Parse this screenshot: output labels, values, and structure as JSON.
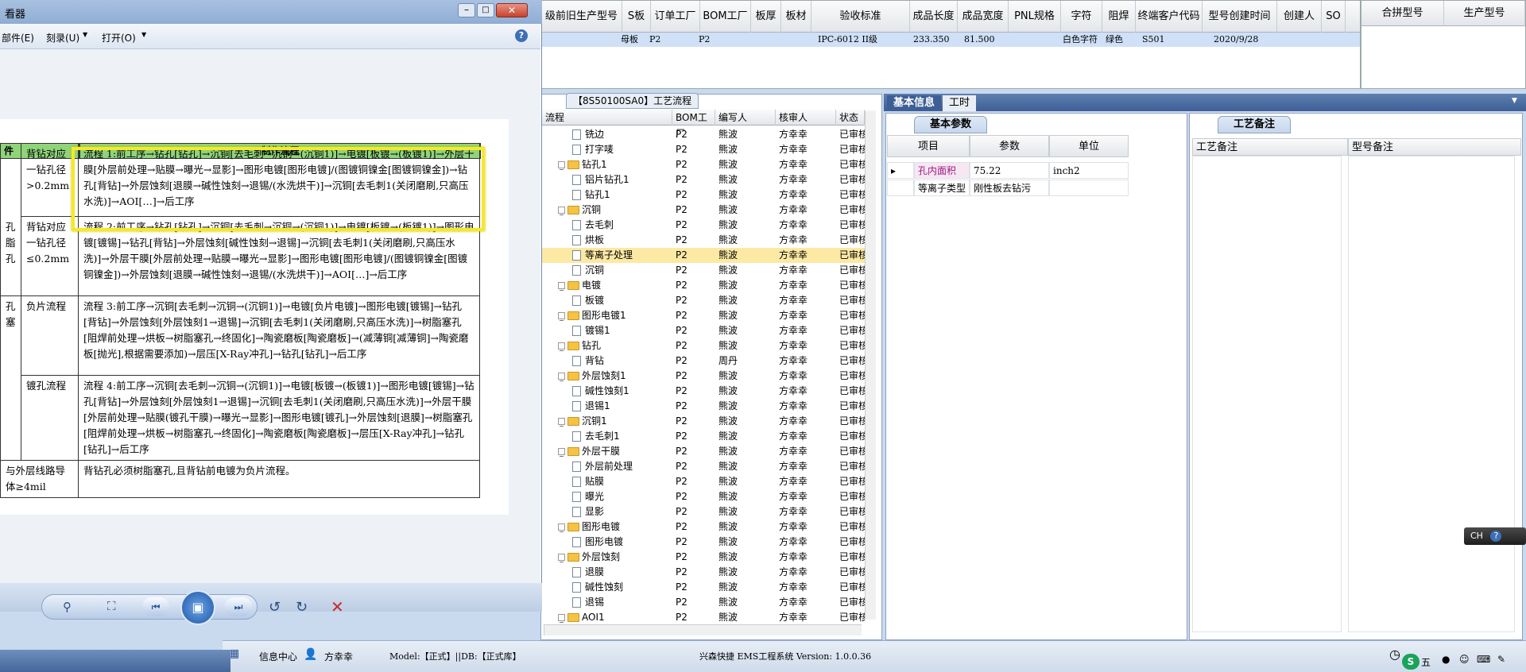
{
  "top_grid": {
    "headers": [
      "级前旧生产型号",
      "S板",
      "订单工厂",
      "BOM工厂",
      "板厚",
      "板材",
      "验收标准",
      "成品长度",
      "成品宽度",
      "PNL规格",
      "字符",
      "阻焊",
      "终端客户代码",
      "型号创建时间",
      "创建人",
      "SO"
    ],
    "row": {
      "s_board": "母板",
      "order_factory": "P2",
      "bom_factory": "P2",
      "standard": "IPC-6012 II级",
      "length": "233.350",
      "width": "81.500",
      "char": "白色字符",
      "mask": "绿色",
      "customer": "S501",
      "created": "2020/9/28"
    },
    "right_headers": [
      "合拼型号",
      "生产型号"
    ]
  },
  "viewer": {
    "title": "看器",
    "menu": [
      "部件(E)",
      "刻录(U)",
      "打开(O)"
    ],
    "table_header_left": "件",
    "table_header_right": "制作流程",
    "rows": [
      {
        "cat": "",
        "cond": "背钻对应一钻孔径>0.2mm",
        "flow": "流程 1:前工序→钻孔[钻孔]→沉铜[去毛刺→沉铜→(沉铜1)]→电镀[板镀→(板镀1)]→外层干膜[外层前处理→贴膜→曝光→显影]→图形电镀[图形电镀]/(图镀铜镍金[图镀铜镍金])→钻孔[背钻]→外层蚀刻[退膜→碱性蚀刻→退锡/(水洗烘干)]→沉铜[去毛刺1(关闭磨刷,只高压水洗)]→AOI[…]→后工序"
      },
      {
        "cat": "孔 脂 孔",
        "cond": "背钻对应一钻孔径≤0.2mm",
        "flow": "流程 2:前工序→钻孔[钻孔]→沉铜[去毛刺→沉铜→(沉铜1)]→电镀[板镀→(板镀1)]→图形电镀[镀锡]→钻孔[背钻]→外层蚀刻[碱性蚀刻→退锡]→沉铜[去毛刺1(关闭磨刷,只高压水洗)]→外层干膜[外层前处理→贴膜→曝光→显影]→图形电镀[图形电镀]/(图镀铜镍金[图镀铜镍金])→外层蚀刻[退膜→碱性蚀刻→退锡/(水洗烘干)]→AOI[…]→后工序"
      },
      {
        "cat": "孔 塞",
        "cond": "负片流程",
        "flow": "流程 3:前工序→沉铜[去毛刺→沉铜→(沉铜1)]→电镀[负片电镀]→图形电镀[镀锡]→钻孔[背钻]→外层蚀刻[外层蚀刻1→退锡]→沉铜[去毛刺1(关闭磨刷,只高压水洗)]→树脂塞孔[阻焊前处理→烘板→树脂塞孔→终固化]→陶瓷磨板[陶瓷磨板]→(减薄铜[减薄铜]→陶瓷磨板[抛光],根据需要添加)→层压[X-Ray冲孔]→钻孔[钻孔]→后工序"
      },
      {
        "cat": "",
        "cond": "镀孔流程",
        "flow": "流程 4:前工序→沉铜[去毛刺→沉铜→(沉铜1)]→电镀[板镀→(板镀1)]→图形电镀[镀锡]→钻孔[背钻]→外层蚀刻[外层蚀刻1→退锡]→沉铜[去毛刺1(关闭磨刷,只高压水洗)]→外层干膜[外层前处理→贴膜(镀孔干膜)→曝光→显影]→图形电镀[镀孔]→外层蚀刻[退膜]→树脂塞孔[阻焊前处理→烘板→树脂塞孔→终固化]→陶瓷磨板[陶瓷磨板]→层压[X-Ray冲孔]→钻孔[钻孔]→后工序"
      },
      {
        "cat": "与外层线路导体≥4mil",
        "cond": "",
        "flow": "背钻孔必须树脂塞孔,且背钻前电镀为负片流程。"
      }
    ]
  },
  "tree": {
    "tab": "【8S50100SA0】工艺流程",
    "headers": [
      "流程",
      "BOM工厂",
      "编写人",
      "核审人",
      "状态"
    ],
    "rows": [
      {
        "lvl": 2,
        "type": "doc",
        "name": "铣边",
        "bom": "P2",
        "w": "熊波",
        "r": "方幸幸",
        "s": "已审核"
      },
      {
        "lvl": 2,
        "type": "doc",
        "name": "打字唛",
        "bom": "P2",
        "w": "熊波",
        "r": "方幸幸",
        "s": "已审核"
      },
      {
        "lvl": 1,
        "type": "fold",
        "name": "钻孔1",
        "bom": "P2",
        "w": "熊波",
        "r": "方幸幸",
        "s": "已审核"
      },
      {
        "lvl": 2,
        "type": "doc",
        "name": "铝片钻孔1",
        "bom": "P2",
        "w": "熊波",
        "r": "方幸幸",
        "s": "已审核"
      },
      {
        "lvl": 2,
        "type": "doc",
        "name": "钻孔1",
        "bom": "P2",
        "w": "熊波",
        "r": "方幸幸",
        "s": "已审核"
      },
      {
        "lvl": 1,
        "type": "fold",
        "name": "沉铜",
        "bom": "P2",
        "w": "熊波",
        "r": "方幸幸",
        "s": "已审核"
      },
      {
        "lvl": 2,
        "type": "doc",
        "name": "去毛刺",
        "bom": "P2",
        "w": "熊波",
        "r": "方幸幸",
        "s": "已审核"
      },
      {
        "lvl": 2,
        "type": "doc",
        "name": "烘板",
        "bom": "P2",
        "w": "熊波",
        "r": "方幸幸",
        "s": "已审核"
      },
      {
        "lvl": 2,
        "type": "doc",
        "name": "等离子处理",
        "bom": "P2",
        "w": "熊波",
        "r": "方幸幸",
        "s": "已审核",
        "sel": true
      },
      {
        "lvl": 2,
        "type": "doc",
        "name": "沉铜",
        "bom": "P2",
        "w": "熊波",
        "r": "方幸幸",
        "s": "已审核"
      },
      {
        "lvl": 1,
        "type": "fold",
        "name": "电镀",
        "bom": "P2",
        "w": "熊波",
        "r": "方幸幸",
        "s": "已审核"
      },
      {
        "lvl": 2,
        "type": "doc",
        "name": "板镀",
        "bom": "P2",
        "w": "熊波",
        "r": "方幸幸",
        "s": "已审核"
      },
      {
        "lvl": 1,
        "type": "fold",
        "name": "图形电镀1",
        "bom": "P2",
        "w": "熊波",
        "r": "方幸幸",
        "s": "已审核"
      },
      {
        "lvl": 2,
        "type": "doc",
        "name": "镀锡1",
        "bom": "P2",
        "w": "熊波",
        "r": "方幸幸",
        "s": "已审核"
      },
      {
        "lvl": 1,
        "type": "fold",
        "name": "钻孔",
        "bom": "P2",
        "w": "熊波",
        "r": "方幸幸",
        "s": "已审核"
      },
      {
        "lvl": 2,
        "type": "doc",
        "name": "背钻",
        "bom": "P2",
        "w": "周丹",
        "r": "方幸幸",
        "s": "已审核"
      },
      {
        "lvl": 1,
        "type": "fold",
        "name": "外层蚀刻1",
        "bom": "P2",
        "w": "熊波",
        "r": "方幸幸",
        "s": "已审核"
      },
      {
        "lvl": 2,
        "type": "doc",
        "name": "碱性蚀刻1",
        "bom": "P2",
        "w": "熊波",
        "r": "方幸幸",
        "s": "已审核"
      },
      {
        "lvl": 2,
        "type": "doc",
        "name": "退锡1",
        "bom": "P2",
        "w": "熊波",
        "r": "方幸幸",
        "s": "已审核"
      },
      {
        "lvl": 1,
        "type": "fold",
        "name": "沉铜1",
        "bom": "P2",
        "w": "熊波",
        "r": "方幸幸",
        "s": "已审核"
      },
      {
        "lvl": 2,
        "type": "doc",
        "name": "去毛刺1",
        "bom": "P2",
        "w": "熊波",
        "r": "方幸幸",
        "s": "已审核"
      },
      {
        "lvl": 1,
        "type": "fold",
        "name": "外层干膜",
        "bom": "P2",
        "w": "熊波",
        "r": "方幸幸",
        "s": "已审核"
      },
      {
        "lvl": 2,
        "type": "doc",
        "name": "外层前处理",
        "bom": "P2",
        "w": "熊波",
        "r": "方幸幸",
        "s": "已审核"
      },
      {
        "lvl": 2,
        "type": "doc",
        "name": "贴膜",
        "bom": "P2",
        "w": "熊波",
        "r": "方幸幸",
        "s": "已审核"
      },
      {
        "lvl": 2,
        "type": "doc",
        "name": "曝光",
        "bom": "P2",
        "w": "熊波",
        "r": "方幸幸",
        "s": "已审核"
      },
      {
        "lvl": 2,
        "type": "doc",
        "name": "显影",
        "bom": "P2",
        "w": "熊波",
        "r": "方幸幸",
        "s": "已审核"
      },
      {
        "lvl": 1,
        "type": "fold",
        "name": "图形电镀",
        "bom": "P2",
        "w": "熊波",
        "r": "方幸幸",
        "s": "已审核"
      },
      {
        "lvl": 2,
        "type": "doc",
        "name": "图形电镀",
        "bom": "P2",
        "w": "熊波",
        "r": "方幸幸",
        "s": "已审核"
      },
      {
        "lvl": 1,
        "type": "fold",
        "name": "外层蚀刻",
        "bom": "P2",
        "w": "熊波",
        "r": "方幸幸",
        "s": "已审核"
      },
      {
        "lvl": 2,
        "type": "doc",
        "name": "退膜",
        "bom": "P2",
        "w": "熊波",
        "r": "方幸幸",
        "s": "已审核"
      },
      {
        "lvl": 2,
        "type": "doc",
        "name": "碱性蚀刻",
        "bom": "P2",
        "w": "熊波",
        "r": "方幸幸",
        "s": "已审核"
      },
      {
        "lvl": 2,
        "type": "doc",
        "name": "退锡",
        "bom": "P2",
        "w": "熊波",
        "r": "方幸幸",
        "s": "已审核"
      },
      {
        "lvl": 1,
        "type": "fold",
        "name": "AOI1",
        "bom": "P2",
        "w": "熊波",
        "r": "方幸幸",
        "s": "已审核"
      }
    ]
  },
  "info": {
    "tabs": [
      "基本信息",
      "工时"
    ],
    "subtab": "基本参数",
    "headers": [
      "项目",
      "参数",
      "单位"
    ],
    "rows": [
      {
        "item": "孔内面积",
        "param": "75.22",
        "unit": "inch2"
      },
      {
        "item": "等离子类型",
        "param": "刚性板去钻污",
        "unit": ""
      }
    ]
  },
  "notes": {
    "subtab": "工艺备注",
    "headers": [
      "工艺备注",
      "型号备注"
    ]
  },
  "status": {
    "left": "信息中心",
    "user": "方幸幸",
    "model": "Model:【正式】||DB:【正式库】",
    "system": "兴森快捷 EMS工程系统 Version: 1.0.0.36",
    "lang": "CH",
    "ime": "五"
  },
  "colors": {
    "selected_row": "#fce9a4",
    "grid_row": "#cfe0f7",
    "highlight": "#f5e92a",
    "tab_bar": "#3d5f96"
  }
}
